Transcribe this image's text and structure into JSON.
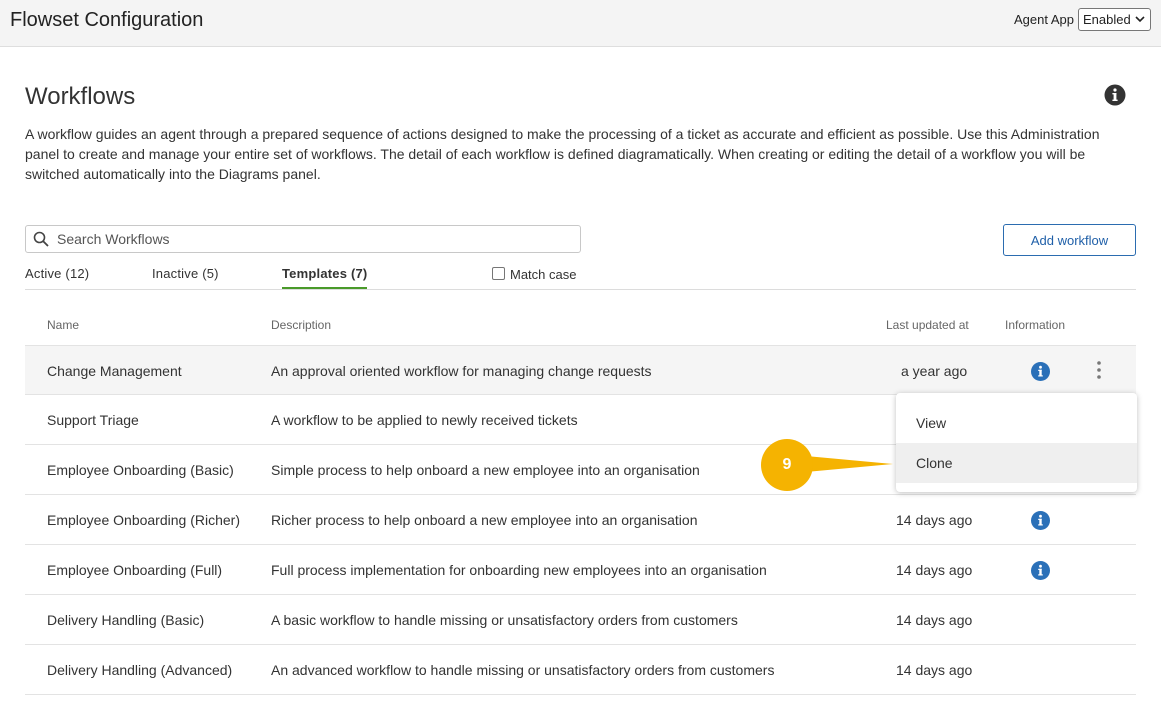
{
  "header": {
    "app_title": "Flowset Configuration",
    "agent_app_label": "Agent App",
    "agent_app_value": "Enabled"
  },
  "page": {
    "title": "Workflows",
    "intro": "A workflow guides an agent through a prepared sequence of actions designed to make the processing of a ticket as accurate and efficient as possible. Use this Administration panel to create and manage your entire set of workflows. The detail of each workflow is defined diagramatically. When creating or editing the detail of a workflow you will be switched automatically into the Diagrams panel."
  },
  "search": {
    "placeholder": "Search Workflows"
  },
  "add_button": "Add workflow",
  "tabs": [
    {
      "label": "Active (12)",
      "active": false
    },
    {
      "label": "Inactive (5)",
      "active": false
    },
    {
      "label": "Templates (7)",
      "active": true
    }
  ],
  "match_case": {
    "label": "Match case",
    "checked": false
  },
  "table": {
    "headers": {
      "name": "Name",
      "description": "Description",
      "updated": "Last updated at",
      "info": "Information"
    },
    "rows": [
      {
        "name": "Change Management",
        "description": "An approval oriented workflow for managing change requests",
        "updated": "a year ago",
        "info_icon": true,
        "menu_icon": true
      },
      {
        "name": "Support Triage",
        "description": "A workflow to be applied to newly received tickets",
        "updated": "",
        "info_icon": false,
        "menu_icon": false
      },
      {
        "name": "Employee Onboarding (Basic)",
        "description": "Simple process to help onboard a new employee into an organisation",
        "updated": "",
        "info_icon": false,
        "menu_icon": false
      },
      {
        "name": "Employee Onboarding (Richer)",
        "description": "Richer process to help onboard a new employee into an organisation",
        "updated": "14 days ago",
        "info_icon": true,
        "menu_icon": false
      },
      {
        "name": "Employee Onboarding (Full)",
        "description": "Full process implementation for onboarding new employees into an organisation",
        "updated": "14 days ago",
        "info_icon": true,
        "menu_icon": false
      },
      {
        "name": "Delivery Handling (Basic)",
        "description": "A basic workflow to handle missing or unsatisfactory orders from customers",
        "updated": "14 days ago",
        "info_icon": false,
        "menu_icon": false
      },
      {
        "name": "Delivery Handling (Advanced)",
        "description": "An advanced workflow to handle missing or unsatisfactory orders from customers",
        "updated": "14 days ago",
        "info_icon": false,
        "menu_icon": false
      }
    ]
  },
  "context_menu": {
    "items": [
      {
        "label": "View",
        "highlighted": false
      },
      {
        "label": "Clone",
        "highlighted": true
      }
    ]
  },
  "annotation": {
    "badge": "9",
    "color": "#f5b301"
  },
  "colors": {
    "accent_blue": "#2b6cb0",
    "tab_underline": "#4a9a2a",
    "info_blue": "#2a70b8"
  },
  "icons": {
    "info": "info-circle-icon",
    "menu": "kebab-menu-icon",
    "search": "search-icon"
  }
}
